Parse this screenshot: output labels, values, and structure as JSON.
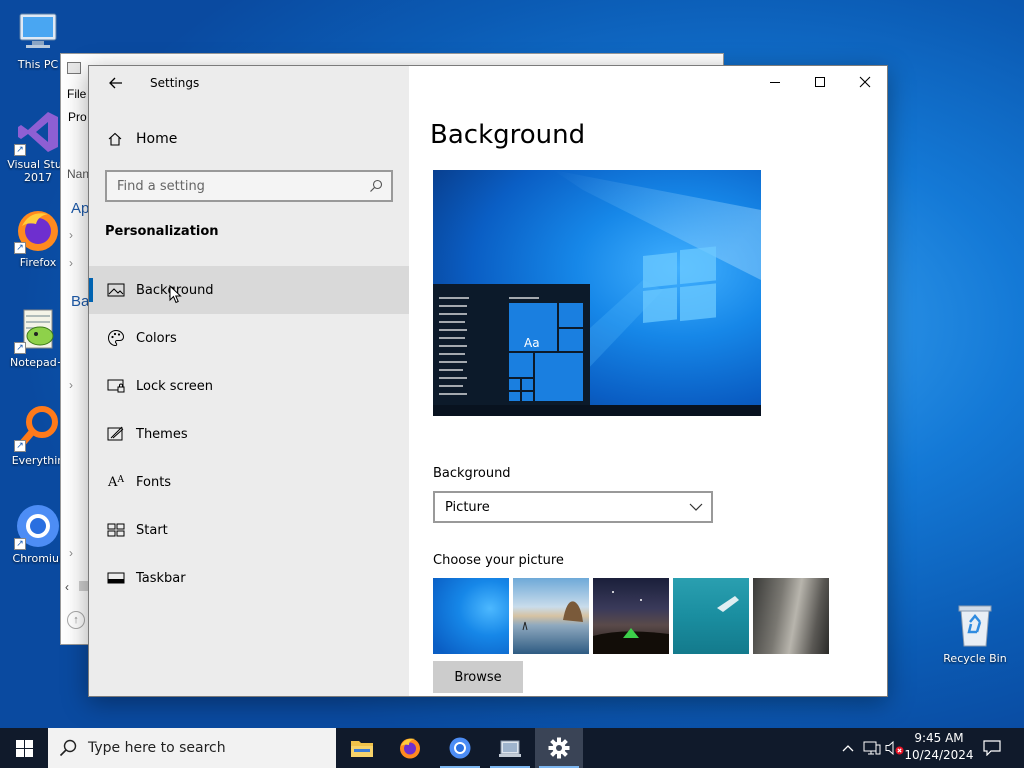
{
  "desktop": {
    "icons": [
      {
        "label": "This PC"
      },
      {
        "label": "Visual Stud",
        "label2": "2017"
      },
      {
        "label": "Firefox"
      },
      {
        "label": "Notepad+"
      },
      {
        "label": "Everythin"
      },
      {
        "label": "Chromiur"
      },
      {
        "label": "Recycle Bin"
      }
    ]
  },
  "background_window": {
    "menu_file": "File",
    "row_label": "Pro",
    "column_header": "Nan",
    "group_a": "Ap",
    "group_b": "Ba"
  },
  "settings": {
    "window_title": "Settings",
    "nav": {
      "home_label": "Home",
      "search_placeholder": "Find a setting",
      "section_heading": "Personalization",
      "items": [
        {
          "label": "Background",
          "icon": "picture-icon",
          "active": true
        },
        {
          "label": "Colors",
          "icon": "palette-icon"
        },
        {
          "label": "Lock screen",
          "icon": "lock-screen-icon"
        },
        {
          "label": "Themes",
          "icon": "themes-icon"
        },
        {
          "label": "Fonts",
          "icon": "fonts-icon"
        },
        {
          "label": "Start",
          "icon": "start-layout-icon"
        },
        {
          "label": "Taskbar",
          "icon": "taskbar-icon"
        }
      ]
    },
    "content": {
      "page_title": "Background",
      "preview_tile_text": "Aa",
      "background_label": "Background",
      "background_value": "Picture",
      "choose_picture_label": "Choose your picture",
      "pictures": [
        "windows-blue",
        "beach-rocks",
        "night-sky-tent",
        "underwater-swimmer",
        "tree-bark"
      ],
      "browse_label": "Browse"
    },
    "accent_color": "#0063b1"
  },
  "taskbar": {
    "search_placeholder": "Type here to search",
    "apps": [
      "file-explorer-icon",
      "firefox-icon",
      "chromium-icon",
      "system-app-icon",
      "settings-gear-icon"
    ],
    "time": "9:45 AM",
    "date": "10/24/2024"
  }
}
